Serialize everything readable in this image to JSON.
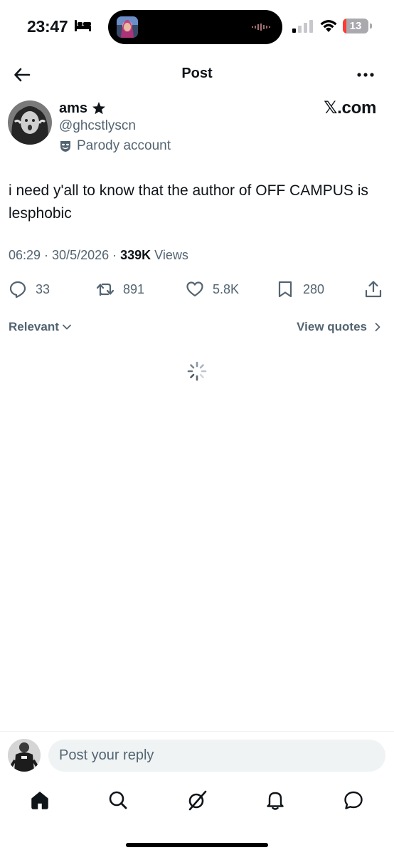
{
  "status_bar": {
    "time": "23:47",
    "battery_level": "13",
    "battery_fraction": 0.13,
    "battery_color": "#ff3b30"
  },
  "header": {
    "title": "Post"
  },
  "post": {
    "author": {
      "name": "ams",
      "handle": "@ghcstlyscn",
      "label": "Parody account"
    },
    "watermark": "𝕏.com",
    "text": "i need y'all to know that the author of OFF CAMPUS is lesphobic",
    "timestamp": "06:29 · 30/5/2026 · ",
    "views_count": "339K",
    "views_label": " Views",
    "actions": {
      "replies": "33",
      "reposts": "891",
      "likes": "5.8K",
      "bookmarks": "280"
    }
  },
  "sort": {
    "label": "Relevant",
    "view_quotes": "View quotes"
  },
  "composer": {
    "placeholder": "Post your reply"
  },
  "colors": {
    "text_primary": "#0f1419",
    "text_secondary": "#536471",
    "input_bg": "#eff3f4"
  },
  "nav": {
    "icons": [
      "home-icon",
      "search-icon",
      "grok-icon",
      "notifications-icon",
      "messages-icon"
    ]
  }
}
